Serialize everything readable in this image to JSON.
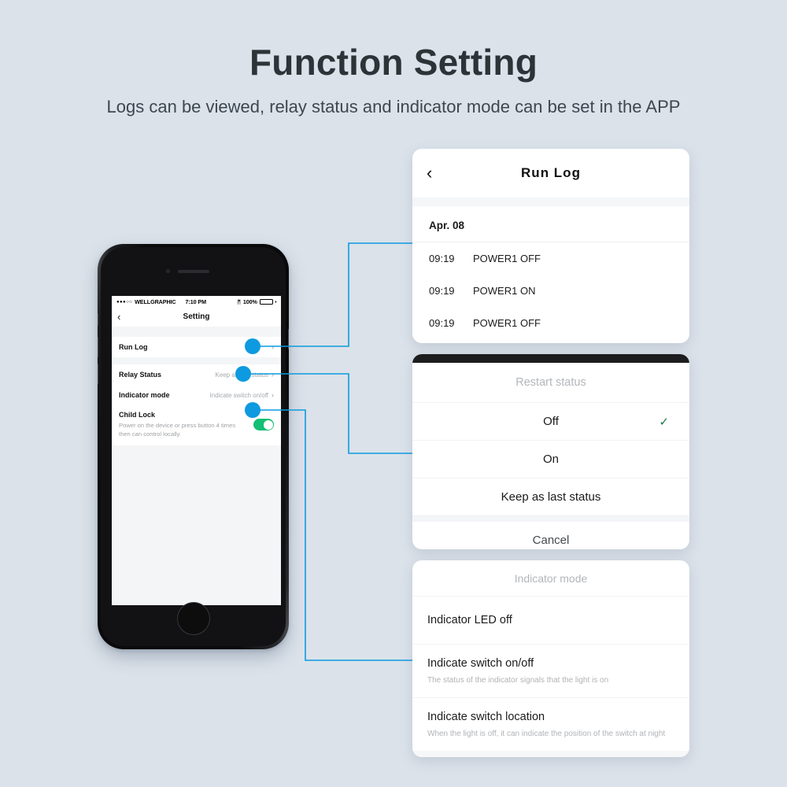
{
  "header": {
    "title": "Function Setting",
    "subtitle": "Logs can be viewed, relay status and indicator mode can be set in the APP"
  },
  "phone": {
    "status_bar": {
      "signal_dots": "●●●○○",
      "carrier": "WELLGRAPHIC",
      "time": "7:10 PM",
      "bluetooth_icon": "ᛗ",
      "battery_percent": "100%"
    },
    "nav": {
      "back_icon": "‹",
      "title": "Setting"
    },
    "rows": [
      {
        "label": "Run Log",
        "value": "",
        "chevron": "›"
      },
      {
        "label": "Relay Status",
        "value": "Keep as last status",
        "chevron": "›"
      },
      {
        "label": "Indicator mode",
        "value": "Indicate switch on/off",
        "chevron": "›"
      }
    ],
    "child_lock": {
      "title": "Child Lock",
      "description": "Power on the device or press button 4 times then can control locally.",
      "toggle_state": "on"
    }
  },
  "cards": {
    "run_log": {
      "back_icon": "‹",
      "title": "Run Log",
      "date": "Apr. 08",
      "entries": [
        {
          "time": "09:19",
          "event": "POWER1 OFF"
        },
        {
          "time": "09:19",
          "event": "POWER1 ON"
        },
        {
          "time": "09:19",
          "event": "POWER1 OFF"
        }
      ]
    },
    "restart_status": {
      "title": "Restart status",
      "options": [
        {
          "label": "Off",
          "selected": true
        },
        {
          "label": "On",
          "selected": false
        },
        {
          "label": "Keep as last status",
          "selected": false
        }
      ],
      "check_icon": "✓",
      "cancel_label": "Cancel"
    },
    "indicator_mode": {
      "title": "Indicator mode",
      "options": [
        {
          "label": "Indicator LED off",
          "description": ""
        },
        {
          "label": "Indicate switch on/off",
          "description": "The status of the indicator signals that the light is on"
        },
        {
          "label": "Indicate switch location",
          "description": "When the light is off, it can indicate the position of the switch at night"
        }
      ]
    }
  },
  "colors": {
    "background": "#dbe2ea",
    "accent": "#0d9ae0",
    "toggle_on": "#12bf74",
    "check": "#1f7a4d",
    "title_text": "#2d3438"
  }
}
